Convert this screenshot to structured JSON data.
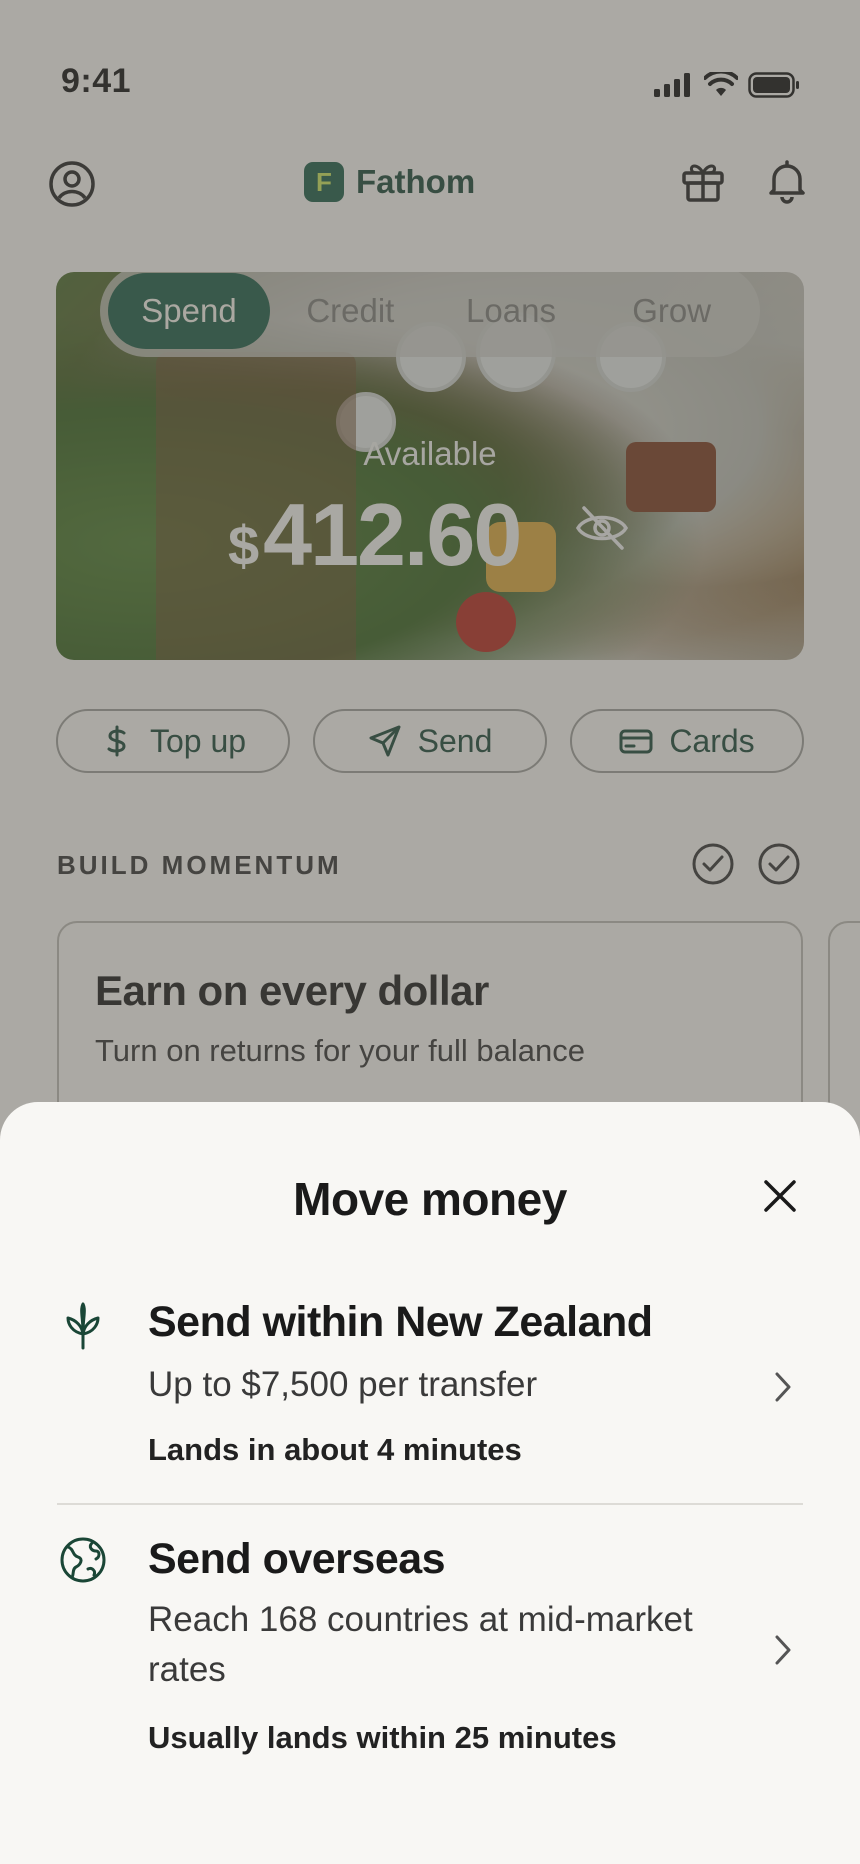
{
  "status_bar": {
    "time": "9:41",
    "icons": [
      "signal-icon",
      "wifi-icon",
      "battery-icon"
    ]
  },
  "header": {
    "brand_initial": "F",
    "brand_name": "Fathom",
    "icons": [
      "profile-icon",
      "gift-icon",
      "bell-icon"
    ]
  },
  "hero": {
    "tabs": [
      {
        "label": "Spend",
        "active": true
      },
      {
        "label": "Credit",
        "active": false
      },
      {
        "label": "Loans",
        "active": false
      },
      {
        "label": "Grow",
        "active": false
      }
    ],
    "available_label": "Available",
    "currency_symbol": "$",
    "balance": "412.60",
    "visibility_icon": "eye-off-icon"
  },
  "actions": [
    {
      "label": "Top up",
      "icon": "dollar-icon"
    },
    {
      "label": "Send",
      "icon": "send-icon"
    },
    {
      "label": "Cards",
      "icon": "card-icon"
    }
  ],
  "build_momentum": {
    "title": "BUILD MOMENTUM",
    "card": {
      "title": "Earn on every dollar",
      "subtitle": "Turn on returns for your full balance"
    }
  },
  "sheet": {
    "title": "Move money",
    "options": [
      {
        "title": "Send within New Zealand",
        "subtitle": "Up to $7,500 per transfer",
        "note": "Lands in about 4 minutes",
        "icon": "fern-icon"
      },
      {
        "title": "Send overseas",
        "subtitle": "Reach 168 countries at mid-market rates",
        "note": "Usually lands within 25 minutes",
        "icon": "globe-icon"
      }
    ]
  },
  "colors": {
    "brand_green": "#1c5a45",
    "brand_lime": "#c9e35b",
    "sheet_bg": "#f8f7f4"
  }
}
